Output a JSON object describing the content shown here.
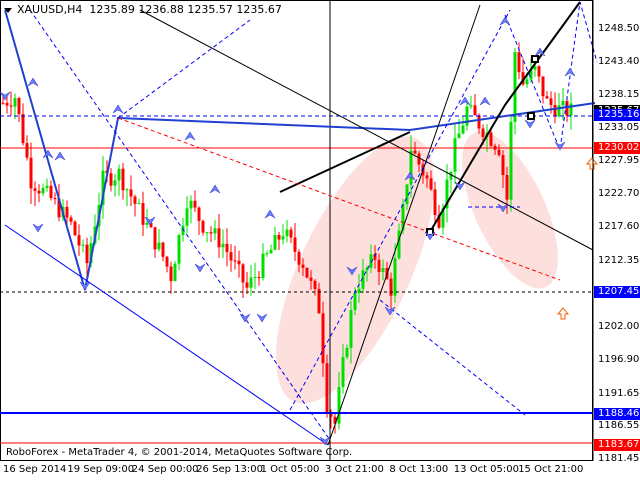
{
  "header": {
    "symbol": "XAUUSD,H4",
    "ohlc": "1235.89 1236.88 1235.57 1235.67"
  },
  "footer": {
    "copyright": "RoboForex - MetaTrader 4, © 2001-2014, MetaQuotes Software Corp."
  },
  "price_axis": {
    "ticks": [
      "1248.50",
      "1243.40",
      "1238.15",
      "1233.05",
      "1227.95",
      "1222.70",
      "1217.60",
      "1212.35",
      "1202.00",
      "1196.90",
      "1191.65",
      "1186.55",
      "1181.45"
    ],
    "range": [
      1181.45,
      1248.5
    ]
  },
  "price_boxes": [
    {
      "label": "1235.67",
      "value": 1235.67,
      "color": "#000000"
    },
    {
      "label": "1235.16",
      "value": 1235.16,
      "color": "#0000ff"
    },
    {
      "label": "1230.02",
      "value": 1230.02,
      "color": "#ff0000"
    },
    {
      "label": "1207.45",
      "value": 1207.45,
      "color": "#0000ff"
    },
    {
      "label": "1188.46",
      "value": 1188.46,
      "color": "#0000ff"
    },
    {
      "label": "1183.67",
      "value": 1183.67,
      "color": "#ff0000"
    }
  ],
  "time_axis": [
    "16 Sep 2014",
    "19 Sep 09:00",
    "24 Sep 00:00",
    "26 Sep 13:00",
    "1 Oct 05:00",
    "3 Oct 21:00",
    "8 Oct 13:00",
    "13 Oct 05:00",
    "15 Oct 21:00"
  ],
  "chart_data": {
    "type": "candlestick",
    "symbol": "XAUUSD",
    "timeframe": "H4",
    "anchors": [
      [
        0,
        1237
      ],
      [
        3,
        1238
      ],
      [
        7,
        1225
      ],
      [
        12,
        1222
      ],
      [
        17,
        1218
      ],
      [
        21,
        1212
      ],
      [
        25,
        1225
      ],
      [
        29,
        1226
      ],
      [
        35,
        1219
      ],
      [
        40,
        1213
      ],
      [
        42,
        1210
      ],
      [
        46,
        1222
      ],
      [
        50,
        1218
      ],
      [
        55,
        1215
      ],
      [
        61,
        1208
      ],
      [
        65,
        1212
      ],
      [
        70,
        1217
      ],
      [
        75,
        1212
      ],
      [
        79,
        1205
      ],
      [
        81,
        1190
      ],
      [
        83,
        1187
      ],
      [
        85,
        1196
      ],
      [
        88,
        1208
      ],
      [
        93,
        1213
      ],
      [
        97,
        1208
      ],
      [
        100,
        1220
      ],
      [
        102,
        1230
      ],
      [
        106,
        1225
      ],
      [
        109,
        1219
      ],
      [
        113,
        1230
      ],
      [
        116,
        1236
      ],
      [
        120,
        1233
      ],
      [
        124,
        1230
      ],
      [
        126,
        1222
      ],
      [
        128,
        1245
      ],
      [
        130,
        1240
      ],
      [
        133,
        1242
      ],
      [
        136,
        1237
      ],
      [
        139,
        1236
      ],
      [
        142,
        1235.67
      ]
    ],
    "colors": {
      "up": "#00e000",
      "down": "#ff0000"
    }
  }
}
